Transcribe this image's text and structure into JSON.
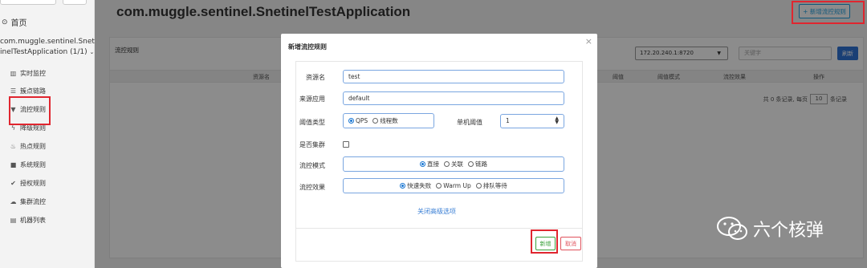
{
  "sidebar": {
    "home_label": "首页",
    "app_line1": "com.muggle.sentinel.Snet",
    "app_line2": "inelTestApplication",
    "app_count": "(1/1)",
    "items": [
      {
        "label": "实时监控",
        "icon": "bar-chart-icon"
      },
      {
        "label": "簇点链路",
        "icon": "list-icon"
      },
      {
        "label": "流控规则",
        "icon": "filter-icon"
      },
      {
        "label": "降级规则",
        "icon": "flash-icon"
      },
      {
        "label": "热点规则",
        "icon": "fire-icon"
      },
      {
        "label": "系统规则",
        "icon": "lock-icon"
      },
      {
        "label": "授权规则",
        "icon": "check-circle-icon"
      },
      {
        "label": "集群流控",
        "icon": "cloud-icon"
      },
      {
        "label": "机器列表",
        "icon": "grid-list-icon"
      }
    ]
  },
  "header": {
    "title": "com.muggle.sentinel.SnetinelTestApplication",
    "add_button_label": "+ 新增流控规则"
  },
  "panel": {
    "title": "流控规则",
    "ip_select_value": "172.20.240.1:8720",
    "search_placeholder": "关键字",
    "refresh_label": "刷新",
    "columns": {
      "resource": "资源名",
      "threshold": "阈值",
      "mode": "阈值模式",
      "effect": "流控效果",
      "ops": "操作"
    },
    "pager": {
      "prefix": "共 0 条记录, 每页",
      "page_size": "10",
      "suffix": "条记录"
    }
  },
  "modal": {
    "title": "新增流控规则",
    "close_label": "×",
    "fields": {
      "resource_label": "资源名",
      "resource_value": "test",
      "origin_label": "来源应用",
      "origin_value": "default",
      "threshold_type_label": "阈值类型",
      "threshold_type_options": [
        "QPS",
        "线程数"
      ],
      "single_threshold_label": "单机阈值",
      "single_threshold_value": "1",
      "cluster_label": "是否集群",
      "mode_label": "流控模式",
      "mode_options": [
        "直接",
        "关联",
        "链路"
      ],
      "effect_label": "流控效果",
      "effect_options": [
        "快速失败",
        "Warm Up",
        "排队等待"
      ]
    },
    "advanced_link": "关闭高级选项",
    "add_label": "新增",
    "cancel_label": "取消"
  },
  "watermark": {
    "text": "六个核弹"
  },
  "colors": {
    "primary": "#1e9fe0",
    "refresh": "#2f73d6",
    "add_green": "#3aa03a",
    "cancel_red": "#e0525c",
    "highlight_red": "#e0262f"
  }
}
